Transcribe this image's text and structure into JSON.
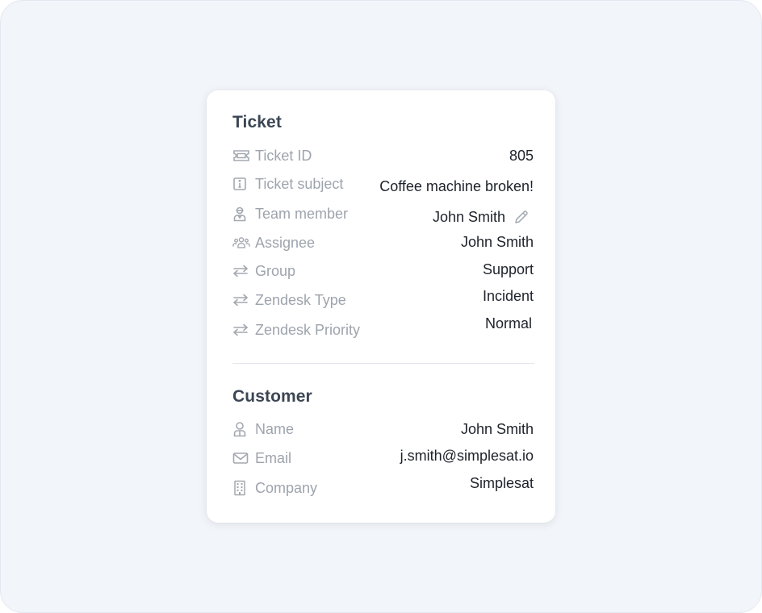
{
  "ticket": {
    "title": "Ticket",
    "rows": [
      {
        "icon": "ticket-icon",
        "label": "Ticket ID",
        "value": "805"
      },
      {
        "icon": "info-icon",
        "label": "Ticket subject",
        "value": "Coffee machine broken!"
      },
      {
        "icon": "team-member-icon",
        "label": "Team member",
        "value": "John Smith",
        "action_icon": "pencil-icon"
      },
      {
        "icon": "users-icon",
        "label": "Assignee",
        "value": "John Smith"
      },
      {
        "icon": "swap-arrows-icon",
        "label": "Group",
        "value": "Support"
      },
      {
        "icon": "swap-arrows-icon",
        "label": "Zendesk Type",
        "value": "Incident"
      },
      {
        "icon": "swap-arrows-icon",
        "label": "Zendesk Priority",
        "value": "Normal"
      }
    ]
  },
  "customer": {
    "title": "Customer",
    "rows": [
      {
        "icon": "person-icon",
        "label": "Name",
        "value": "John Smith"
      },
      {
        "icon": "envelope-icon",
        "label": "Email",
        "value": "j.smith@simplesat.io"
      },
      {
        "icon": "building-icon",
        "label": "Company",
        "value": "Simplesat"
      }
    ]
  },
  "colors": {
    "page_background": "#f2f5f9",
    "card_background": "#ffffff",
    "heading": "#3c4654",
    "label": "#9ea4ad",
    "value": "#1d222a",
    "icon": "#a3a8b0"
  }
}
